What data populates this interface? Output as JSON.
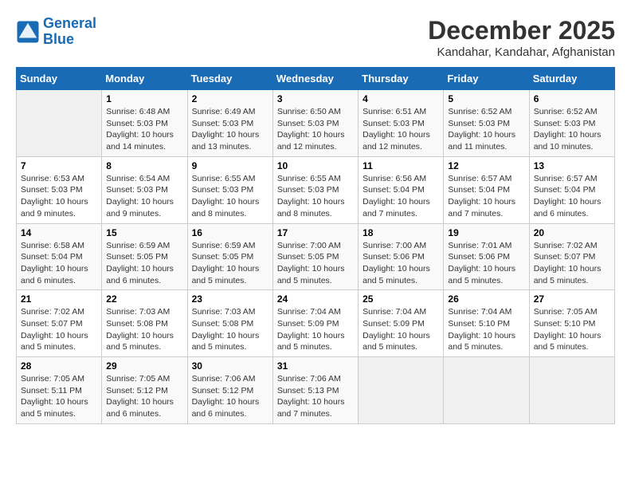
{
  "header": {
    "logo_line1": "General",
    "logo_line2": "Blue",
    "month": "December 2025",
    "location": "Kandahar, Kandahar, Afghanistan"
  },
  "weekdays": [
    "Sunday",
    "Monday",
    "Tuesday",
    "Wednesday",
    "Thursday",
    "Friday",
    "Saturday"
  ],
  "weeks": [
    [
      {
        "day": "",
        "info": ""
      },
      {
        "day": "1",
        "info": "Sunrise: 6:48 AM\nSunset: 5:03 PM\nDaylight: 10 hours\nand 14 minutes."
      },
      {
        "day": "2",
        "info": "Sunrise: 6:49 AM\nSunset: 5:03 PM\nDaylight: 10 hours\nand 13 minutes."
      },
      {
        "day": "3",
        "info": "Sunrise: 6:50 AM\nSunset: 5:03 PM\nDaylight: 10 hours\nand 12 minutes."
      },
      {
        "day": "4",
        "info": "Sunrise: 6:51 AM\nSunset: 5:03 PM\nDaylight: 10 hours\nand 12 minutes."
      },
      {
        "day": "5",
        "info": "Sunrise: 6:52 AM\nSunset: 5:03 PM\nDaylight: 10 hours\nand 11 minutes."
      },
      {
        "day": "6",
        "info": "Sunrise: 6:52 AM\nSunset: 5:03 PM\nDaylight: 10 hours\nand 10 minutes."
      }
    ],
    [
      {
        "day": "7",
        "info": "Sunrise: 6:53 AM\nSunset: 5:03 PM\nDaylight: 10 hours\nand 9 minutes."
      },
      {
        "day": "8",
        "info": "Sunrise: 6:54 AM\nSunset: 5:03 PM\nDaylight: 10 hours\nand 9 minutes."
      },
      {
        "day": "9",
        "info": "Sunrise: 6:55 AM\nSunset: 5:03 PM\nDaylight: 10 hours\nand 8 minutes."
      },
      {
        "day": "10",
        "info": "Sunrise: 6:55 AM\nSunset: 5:03 PM\nDaylight: 10 hours\nand 8 minutes."
      },
      {
        "day": "11",
        "info": "Sunrise: 6:56 AM\nSunset: 5:04 PM\nDaylight: 10 hours\nand 7 minutes."
      },
      {
        "day": "12",
        "info": "Sunrise: 6:57 AM\nSunset: 5:04 PM\nDaylight: 10 hours\nand 7 minutes."
      },
      {
        "day": "13",
        "info": "Sunrise: 6:57 AM\nSunset: 5:04 PM\nDaylight: 10 hours\nand 6 minutes."
      }
    ],
    [
      {
        "day": "14",
        "info": "Sunrise: 6:58 AM\nSunset: 5:04 PM\nDaylight: 10 hours\nand 6 minutes."
      },
      {
        "day": "15",
        "info": "Sunrise: 6:59 AM\nSunset: 5:05 PM\nDaylight: 10 hours\nand 6 minutes."
      },
      {
        "day": "16",
        "info": "Sunrise: 6:59 AM\nSunset: 5:05 PM\nDaylight: 10 hours\nand 5 minutes."
      },
      {
        "day": "17",
        "info": "Sunrise: 7:00 AM\nSunset: 5:05 PM\nDaylight: 10 hours\nand 5 minutes."
      },
      {
        "day": "18",
        "info": "Sunrise: 7:00 AM\nSunset: 5:06 PM\nDaylight: 10 hours\nand 5 minutes."
      },
      {
        "day": "19",
        "info": "Sunrise: 7:01 AM\nSunset: 5:06 PM\nDaylight: 10 hours\nand 5 minutes."
      },
      {
        "day": "20",
        "info": "Sunrise: 7:02 AM\nSunset: 5:07 PM\nDaylight: 10 hours\nand 5 minutes."
      }
    ],
    [
      {
        "day": "21",
        "info": "Sunrise: 7:02 AM\nSunset: 5:07 PM\nDaylight: 10 hours\nand 5 minutes."
      },
      {
        "day": "22",
        "info": "Sunrise: 7:03 AM\nSunset: 5:08 PM\nDaylight: 10 hours\nand 5 minutes."
      },
      {
        "day": "23",
        "info": "Sunrise: 7:03 AM\nSunset: 5:08 PM\nDaylight: 10 hours\nand 5 minutes."
      },
      {
        "day": "24",
        "info": "Sunrise: 7:04 AM\nSunset: 5:09 PM\nDaylight: 10 hours\nand 5 minutes."
      },
      {
        "day": "25",
        "info": "Sunrise: 7:04 AM\nSunset: 5:09 PM\nDaylight: 10 hours\nand 5 minutes."
      },
      {
        "day": "26",
        "info": "Sunrise: 7:04 AM\nSunset: 5:10 PM\nDaylight: 10 hours\nand 5 minutes."
      },
      {
        "day": "27",
        "info": "Sunrise: 7:05 AM\nSunset: 5:10 PM\nDaylight: 10 hours\nand 5 minutes."
      }
    ],
    [
      {
        "day": "28",
        "info": "Sunrise: 7:05 AM\nSunset: 5:11 PM\nDaylight: 10 hours\nand 5 minutes."
      },
      {
        "day": "29",
        "info": "Sunrise: 7:05 AM\nSunset: 5:12 PM\nDaylight: 10 hours\nand 6 minutes."
      },
      {
        "day": "30",
        "info": "Sunrise: 7:06 AM\nSunset: 5:12 PM\nDaylight: 10 hours\nand 6 minutes."
      },
      {
        "day": "31",
        "info": "Sunrise: 7:06 AM\nSunset: 5:13 PM\nDaylight: 10 hours\nand 7 minutes."
      },
      {
        "day": "",
        "info": ""
      },
      {
        "day": "",
        "info": ""
      },
      {
        "day": "",
        "info": ""
      }
    ]
  ]
}
